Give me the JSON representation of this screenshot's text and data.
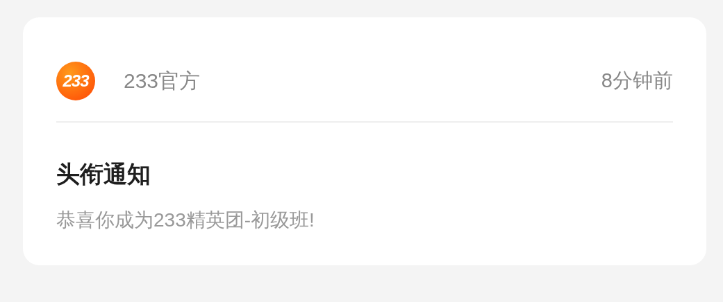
{
  "message": {
    "logo_text": "233",
    "sender": "233官方",
    "time": "8分钟前",
    "title": "头衔通知",
    "body": "恭喜你成为233精英团-初级班!"
  }
}
